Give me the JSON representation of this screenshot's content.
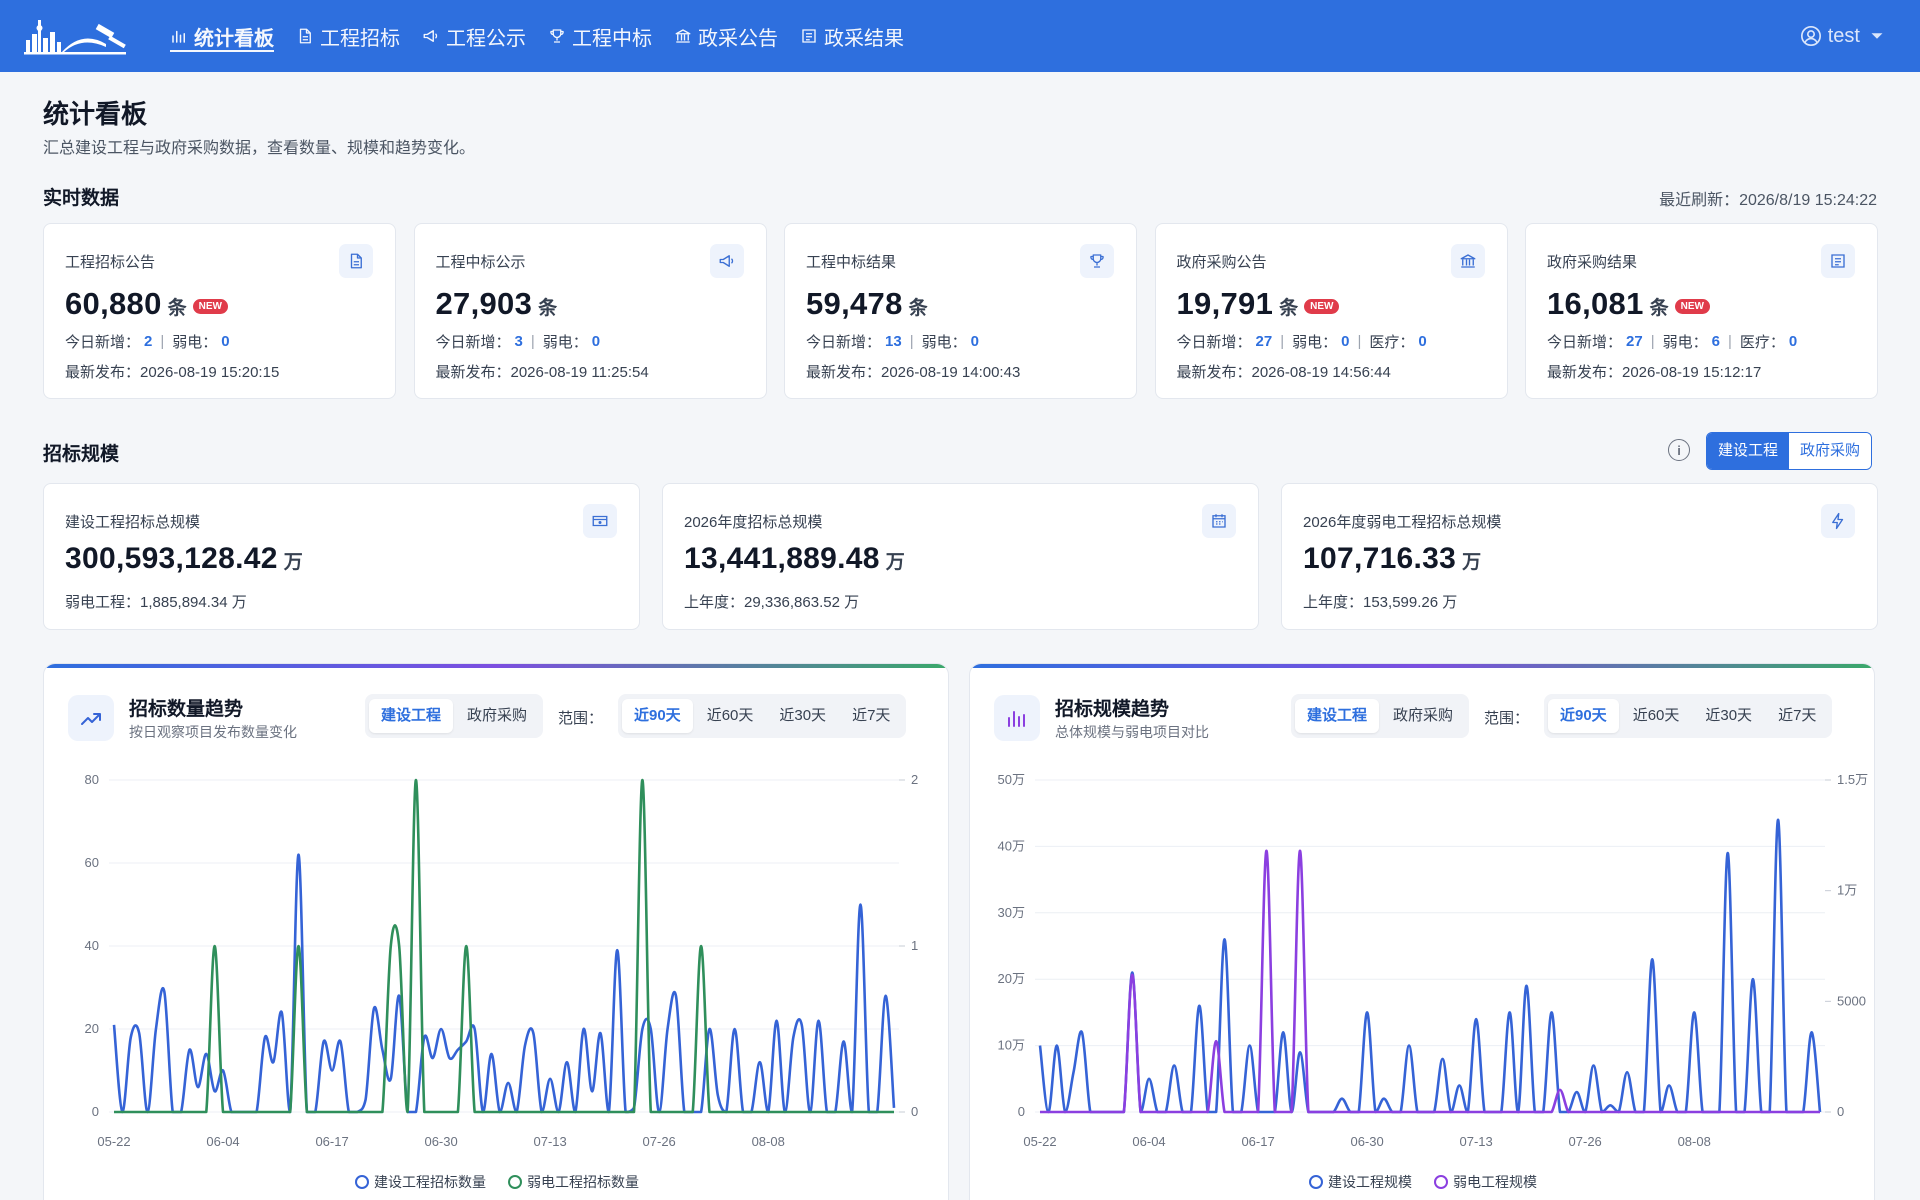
{
  "nav": {
    "items": [
      {
        "label": "统计看板",
        "icon": "bar-chart-icon",
        "active": true
      },
      {
        "label": "工程招标",
        "icon": "document-icon",
        "active": false
      },
      {
        "label": "工程公示",
        "icon": "megaphone-icon",
        "active": false
      },
      {
        "label": "工程中标",
        "icon": "trophy-icon",
        "active": false
      },
      {
        "label": "政采公告",
        "icon": "bank-icon",
        "active": false
      },
      {
        "label": "政采结果",
        "icon": "list-icon",
        "active": false
      }
    ],
    "user": "test"
  },
  "header": {
    "title": "统计看板",
    "subtitle": "汇总建设工程与政府采购数据，查看数量、规模和趋势变化。"
  },
  "realtime": {
    "title": "实时数据",
    "refresh": "最近刷新：2026/8/19 15:24:22",
    "cards": [
      {
        "label": "工程招标公告",
        "icon": "document-icon",
        "value": "60,880",
        "unit": "条",
        "badge": "NEW",
        "meta": [
          {
            "k": "今日新增：",
            "v": "2"
          },
          {
            "k": "弱电：",
            "v": "0"
          }
        ],
        "date": "最新发布：2026-08-19 15:20:15"
      },
      {
        "label": "工程中标公示",
        "icon": "megaphone-icon",
        "value": "27,903",
        "unit": "条",
        "badge": "",
        "meta": [
          {
            "k": "今日新增：",
            "v": "3"
          },
          {
            "k": "弱电：",
            "v": "0"
          }
        ],
        "date": "最新发布：2026-08-19 11:25:54"
      },
      {
        "label": "工程中标结果",
        "icon": "trophy-icon",
        "value": "59,478",
        "unit": "条",
        "badge": "",
        "meta": [
          {
            "k": "今日新增：",
            "v": "13"
          },
          {
            "k": "弱电：",
            "v": "0"
          }
        ],
        "date": "最新发布：2026-08-19 14:00:43"
      },
      {
        "label": "政府采购公告",
        "icon": "bank-icon",
        "value": "19,791",
        "unit": "条",
        "badge": "NEW",
        "meta": [
          {
            "k": "今日新增：",
            "v": "27"
          },
          {
            "k": "弱电：",
            "v": "0"
          },
          {
            "k": "医疗：",
            "v": "0"
          }
        ],
        "date": "最新发布：2026-08-19 14:56:44"
      },
      {
        "label": "政府采购结果",
        "icon": "list-icon",
        "value": "16,081",
        "unit": "条",
        "badge": "NEW",
        "meta": [
          {
            "k": "今日新增：",
            "v": "27"
          },
          {
            "k": "弱电：",
            "v": "6"
          },
          {
            "k": "医疗：",
            "v": "0"
          }
        ],
        "date": "最新发布：2026-08-19 15:12:17"
      }
    ]
  },
  "scale": {
    "title": "招标规模",
    "info_icon": "i",
    "toggle": [
      "建设工程",
      "政府采购"
    ],
    "cards": [
      {
        "label": "建设工程招标总规模",
        "icon": "money-icon",
        "value": "300,593,128.42",
        "unit": "万",
        "meta": "弱电工程：1,885,894.34 万"
      },
      {
        "label": "2026年度招标总规模",
        "icon": "calendar-icon",
        "value": "13,441,889.48",
        "unit": "万",
        "meta": "上年度：29,336,863.52 万"
      },
      {
        "label": "2026年度弱电工程招标总规模",
        "icon": "bolt-icon",
        "value": "107,716.33",
        "unit": "万",
        "meta": "上年度：153,599.26 万"
      }
    ]
  },
  "charts": [
    {
      "title": "招标数量趋势",
      "subtitle": "按日观察项目发布数量变化",
      "icon": "trend-up-icon",
      "seg_type": [
        "建设工程",
        "政府采购"
      ],
      "range_label": "范围：",
      "ranges": [
        "近90天",
        "近60天",
        "近30天",
        "近7天"
      ]
    },
    {
      "title": "招标规模趋势",
      "subtitle": "总体规模与弱电项目对比",
      "icon": "bar-chart-icon",
      "seg_type": [
        "建设工程",
        "政府采购"
      ],
      "range_label": "范围：",
      "ranges": [
        "近90天",
        "近60天",
        "近30天",
        "近7天"
      ]
    }
  ],
  "colors": {
    "brand": "#2e6fde",
    "series_blue": "#3563d6",
    "series_green": "#2f8f5b",
    "series_purple": "#8b3fe0",
    "badge": "#e03b4a"
  },
  "chart_data": [
    {
      "type": "line",
      "x_ticks": [
        "05-22",
        "06-04",
        "06-17",
        "06-30",
        "07-13",
        "07-26",
        "08-08"
      ],
      "ylim": [
        0,
        80
      ],
      "y_ticks": [
        "0",
        "20",
        "40",
        "60",
        "80"
      ],
      "y2lim": [
        0,
        2
      ],
      "y2_ticks": [
        "0",
        "1",
        "2"
      ],
      "series": [
        {
          "name": "建设工程招标数量",
          "axis": "left",
          "color": "#3563d6",
          "values": [
            21,
            0,
            18,
            19,
            0,
            20,
            29,
            0,
            0,
            15,
            6,
            14,
            5,
            10,
            0,
            0,
            0,
            0,
            18,
            12,
            24,
            0,
            62,
            0,
            0,
            17,
            10,
            17,
            0,
            0,
            3,
            25,
            15,
            8,
            28,
            0,
            0,
            18,
            13,
            20,
            13,
            15,
            17,
            20,
            0,
            14,
            0,
            7,
            0,
            16,
            19,
            0,
            8,
            0,
            12,
            0,
            20,
            5,
            19,
            0,
            39,
            0,
            1,
            20,
            20,
            0,
            20,
            28,
            0,
            0,
            0,
            20,
            4,
            0,
            20,
            0,
            0,
            12,
            0,
            22,
            0,
            18,
            21,
            0,
            22,
            0,
            0,
            17,
            0,
            50,
            0,
            0,
            28,
            1
          ]
        },
        {
          "name": "弱电工程招标数量",
          "axis": "right",
          "color": "#2f8f5b",
          "values": [
            0,
            0,
            0,
            0,
            0,
            0,
            0,
            0,
            0,
            0,
            0,
            0,
            1,
            0,
            0,
            0,
            0,
            0,
            0,
            0,
            0,
            0,
            1,
            0,
            0,
            0,
            0,
            0,
            0,
            0,
            0,
            0,
            0,
            1,
            1,
            0,
            2,
            0,
            0,
            0,
            0,
            0,
            1,
            0,
            0,
            0,
            0,
            0,
            0,
            0,
            0,
            0,
            0,
            0,
            0,
            0,
            0,
            0,
            0,
            0,
            0,
            0,
            0,
            2,
            0,
            0,
            0,
            0,
            0,
            0,
            1,
            0,
            0,
            0,
            0,
            0,
            0,
            0,
            0,
            0,
            0,
            0,
            0,
            0,
            0,
            0,
            0,
            0,
            0,
            0,
            0,
            0,
            0,
            0
          ]
        }
      ]
    },
    {
      "type": "line",
      "x_ticks": [
        "05-22",
        "06-04",
        "06-17",
        "06-30",
        "07-13",
        "07-26",
        "08-08"
      ],
      "ylim": [
        0,
        500000
      ],
      "y_ticks": [
        "0",
        "10万",
        "20万",
        "30万",
        "40万",
        "50万"
      ],
      "y2lim": [
        0,
        15000
      ],
      "y2_ticks": [
        "0",
        "5000",
        "1万",
        "1.5万"
      ],
      "series": [
        {
          "name": "建设工程规模",
          "axis": "left",
          "color": "#3563d6",
          "values": [
            100000,
            0,
            100000,
            0,
            60000,
            120000,
            0,
            0,
            0,
            0,
            0,
            210000,
            0,
            50000,
            0,
            0,
            70000,
            0,
            0,
            160000,
            0,
            0,
            260000,
            0,
            0,
            100000,
            0,
            0,
            0,
            120000,
            0,
            90000,
            0,
            0,
            0,
            0,
            20000,
            0,
            0,
            150000,
            0,
            20000,
            0,
            0,
            100000,
            0,
            0,
            0,
            80000,
            0,
            40000,
            0,
            140000,
            0,
            0,
            0,
            150000,
            0,
            190000,
            0,
            0,
            150000,
            0,
            0,
            30000,
            0,
            70000,
            0,
            10000,
            0,
            60000,
            0,
            0,
            230000,
            0,
            40000,
            0,
            0,
            150000,
            0,
            0,
            0,
            390000,
            0,
            0,
            200000,
            0,
            0,
            440000,
            0,
            0,
            0,
            120000,
            0
          ]
        },
        {
          "name": "弱电工程规模",
          "axis": "right",
          "color": "#8b3fe0",
          "values": [
            0,
            0,
            0,
            0,
            0,
            0,
            0,
            0,
            0,
            0,
            0,
            6200,
            0,
            0,
            0,
            0,
            0,
            0,
            0,
            0,
            0,
            3200,
            0,
            0,
            0,
            0,
            0,
            11800,
            0,
            0,
            0,
            11800,
            0,
            0,
            0,
            0,
            0,
            0,
            0,
            0,
            0,
            0,
            0,
            0,
            0,
            0,
            0,
            0,
            0,
            0,
            0,
            0,
            0,
            0,
            0,
            0,
            0,
            0,
            0,
            0,
            0,
            0,
            1000,
            0,
            0,
            0,
            0,
            0,
            0,
            0,
            0,
            0,
            0,
            0,
            0,
            0,
            0,
            0,
            0,
            0,
            0,
            0,
            0,
            0,
            0,
            0,
            0,
            0,
            0,
            0,
            0,
            0,
            0,
            0
          ]
        }
      ]
    }
  ]
}
